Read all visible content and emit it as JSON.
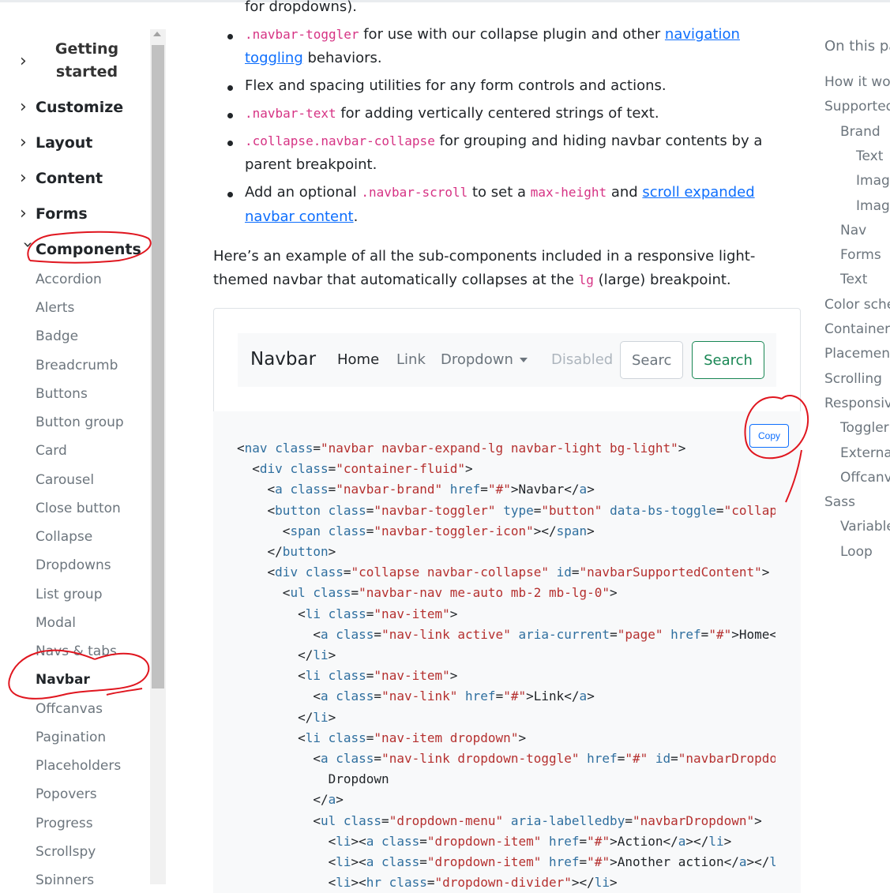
{
  "sidebar": {
    "groups": [
      {
        "label": "Getting started"
      },
      {
        "label": "Customize"
      },
      {
        "label": "Layout"
      },
      {
        "label": "Content"
      },
      {
        "label": "Forms"
      },
      {
        "label": "Components"
      }
    ],
    "items": [
      "Accordion",
      "Alerts",
      "Badge",
      "Breadcrumb",
      "Buttons",
      "Button group",
      "Card",
      "Carousel",
      "Close button",
      "Collapse",
      "Dropdowns",
      "List group",
      "Modal",
      "Navs & tabs",
      "Navbar",
      "Offcanvas",
      "Pagination",
      "Placeholders",
      "Popovers",
      "Progress",
      "Scrollspy",
      "Spinners"
    ],
    "active_item": "Navbar"
  },
  "content": {
    "line0": "for dropdowns).",
    "b1_code": ".navbar-toggler",
    "b1_text": " for use with our collapse plugin and other ",
    "b1_link": "navigation",
    "b1_link2": "toggling",
    "b1_text2": " behaviors.",
    "b2_text": "Flex and spacing utilities for any form controls and actions.",
    "b3_code": ".navbar-text",
    "b3_text": " for adding vertically centered strings of text.",
    "b4_code": ".collapse.navbar-collapse",
    "b4_text": " for grouping and hiding navbar contents by a",
    "b4_text2": "parent breakpoint.",
    "b5_text": "Add an optional ",
    "b5_code": ".navbar-scroll",
    "b5_text2": " to set a ",
    "b5_code2": "max-height",
    "b5_text3": " and ",
    "b5_link": "scroll expanded",
    "b5_link2": "navbar content",
    "b5_end": ".",
    "p1": "Here’s an example of all the sub-components included in a responsive light-",
    "p2a": "themed navbar that automatically collapses at the ",
    "p2code": "lg",
    "p2b": " (large) breakpoint."
  },
  "example": {
    "brand": "Navbar",
    "links": [
      "Home",
      "Link",
      "Dropdown",
      "Disabled"
    ],
    "search_placeholder": "Search",
    "search_button": "Search"
  },
  "code": {
    "copy_label": "Copy",
    "lines": [
      "<nav class=\"navbar navbar-expand-lg navbar-light bg-light\">",
      "  <div class=\"container-fluid\">",
      "    <a class=\"navbar-brand\" href=\"#\">Navbar</a>",
      "    <button class=\"navbar-toggler\" type=\"button\" data-bs-toggle=\"collapse\"",
      "      <span class=\"navbar-toggler-icon\"></span>",
      "    </button>",
      "    <div class=\"collapse navbar-collapse\" id=\"navbarSupportedContent\">",
      "      <ul class=\"navbar-nav me-auto mb-2 mb-lg-0\">",
      "        <li class=\"nav-item\">",
      "          <a class=\"nav-link active\" aria-current=\"page\" href=\"#\">Home</a>",
      "        </li>",
      "        <li class=\"nav-item\">",
      "          <a class=\"nav-link\" href=\"#\">Link</a>",
      "        </li>",
      "        <li class=\"nav-item dropdown\">",
      "          <a class=\"nav-link dropdown-toggle\" href=\"#\" id=\"navbarDropdown\"",
      "            Dropdown",
      "          </a>",
      "          <ul class=\"dropdown-menu\" aria-labelledby=\"navbarDropdown\">",
      "            <li><a class=\"dropdown-item\" href=\"#\">Action</a></li>",
      "            <li><a class=\"dropdown-item\" href=\"#\">Another action</a></li>",
      "            <li><hr class=\"dropdown-divider\"></li>"
    ]
  },
  "toc": {
    "title": "On this page",
    "items": [
      {
        "label": "How it works",
        "level": 0
      },
      {
        "label": "Supported content",
        "level": 0
      },
      {
        "label": "Brand",
        "level": 1
      },
      {
        "label": "Text",
        "level": 2
      },
      {
        "label": "Image",
        "level": 2
      },
      {
        "label": "Image and text",
        "level": 2
      },
      {
        "label": "Nav",
        "level": 1
      },
      {
        "label": "Forms",
        "level": 1
      },
      {
        "label": "Text",
        "level": 1
      },
      {
        "label": "Color schemes",
        "level": 0
      },
      {
        "label": "Containers",
        "level": 0
      },
      {
        "label": "Placement",
        "level": 0
      },
      {
        "label": "Scrolling",
        "level": 0
      },
      {
        "label": "Responsive behaviors",
        "level": 0
      },
      {
        "label": "Toggler",
        "level": 1
      },
      {
        "label": "External content",
        "level": 1
      },
      {
        "label": "Offcanvas",
        "level": 1
      },
      {
        "label": "Sass",
        "level": 0
      },
      {
        "label": "Variables",
        "level": 1
      },
      {
        "label": "Loop",
        "level": 1
      }
    ]
  },
  "colors": {
    "link": "#0d6efd",
    "code_pink": "#d63384",
    "success": "#198754",
    "annotation": "#e0161f"
  }
}
